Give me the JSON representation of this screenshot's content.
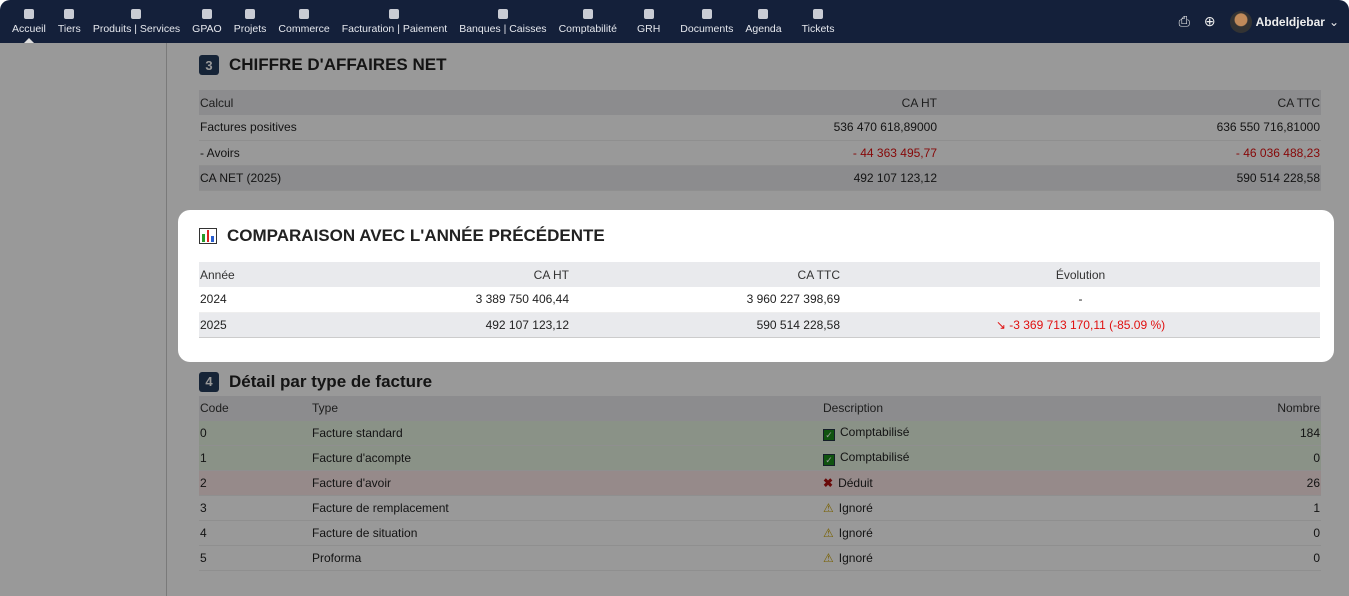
{
  "nav": {
    "items": [
      "Accueil",
      "Tiers",
      "Produits | Services",
      "GPAO",
      "Projets",
      "Commerce",
      "Facturation | Paiement",
      "Banques | Caisses",
      "Comptabilité",
      "GRH",
      "Documents",
      "Agenda",
      "Tickets"
    ],
    "user": "Abdeldjebar"
  },
  "s3": {
    "num": "3",
    "title": "CHIFFRE D'AFFAIRES NET",
    "headers": [
      "Calcul",
      "CA HT",
      "CA TTC"
    ],
    "rows": [
      [
        "Factures positives",
        "536 470 618,89000",
        "636 550 716,81000"
      ],
      [
        "- Avoirs",
        "- 44 363 495,77",
        "- 46 036 488,23"
      ],
      [
        "CA NET (2025)",
        "492 107 123,12",
        "590 514 228,58"
      ]
    ]
  },
  "cmp": {
    "title": "COMPARAISON AVEC L'ANNÉE PRÉCÉDENTE",
    "headers": [
      "Année",
      "CA HT",
      "CA TTC",
      "Évolution"
    ],
    "rows": [
      [
        "2024",
        "3 389 750 406,44",
        "3 960 227 398,69",
        "-"
      ],
      [
        "2025",
        "492 107 123,12",
        "590 514 228,58",
        "↘ -3 369 713 170,11 (-85.09 %)"
      ]
    ]
  },
  "s4": {
    "num": "4",
    "title": "Détail par type de facture",
    "headers": [
      "Code",
      "Type",
      "Description",
      "Nombre"
    ],
    "rows": [
      [
        "0",
        "Facture standard",
        "Comptabilisé",
        "184"
      ],
      [
        "1",
        "Facture d'acompte",
        "Comptabilisé",
        "0"
      ],
      [
        "2",
        "Facture d'avoir",
        "Déduit",
        "26"
      ],
      [
        "3",
        "Facture de remplacement",
        "Ignoré",
        "1"
      ],
      [
        "4",
        "Facture de situation",
        "Ignoré",
        "0"
      ],
      [
        "5",
        "Proforma",
        "Ignoré",
        "0"
      ]
    ]
  }
}
